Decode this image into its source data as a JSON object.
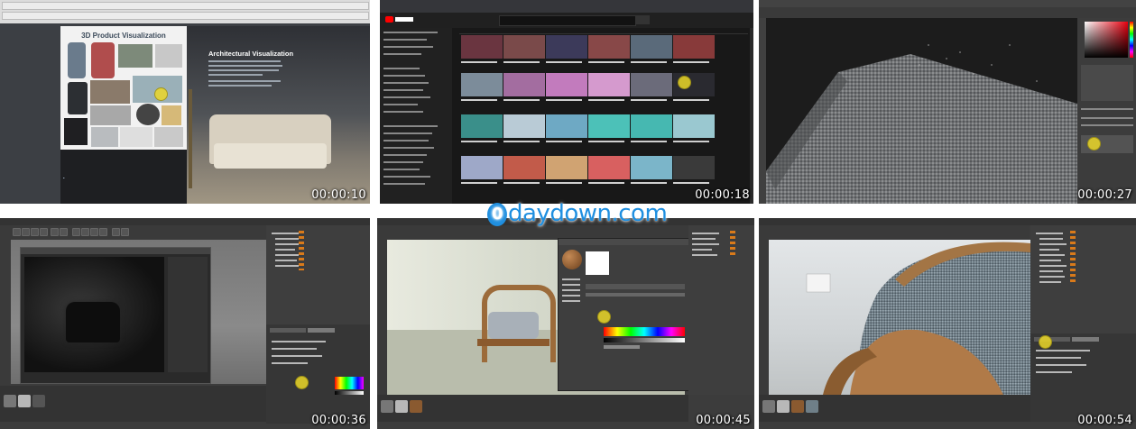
{
  "timestamps": [
    "00:00:10",
    "00:00:18",
    "00:00:27",
    "00:00:36",
    "00:00:45",
    "00:00:54"
  ],
  "tile1": {
    "left_heading": "3D Product Visualization",
    "right_heading": "Architectural Visualization"
  },
  "watermark": {
    "text": "daydown.com",
    "logo_glyph": "0"
  },
  "colors": {
    "cursor": "#ebd728",
    "watermark": "#1f8fe0",
    "youtube_red": "#ff0000"
  }
}
